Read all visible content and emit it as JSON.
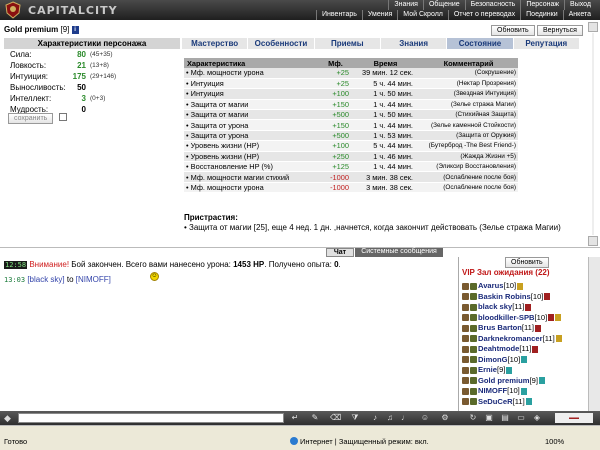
{
  "header": {
    "logo_text": "CAPITALCITY",
    "menu_row1": [
      "Знания",
      "Общение",
      "Безопасность",
      "Персонаж",
      "Выход"
    ],
    "menu_row2": [
      "Инвентарь",
      "Умения",
      "Мой Скролл",
      "Отчет о переводах",
      "Поединки",
      "Анкета"
    ]
  },
  "player": {
    "name": "Gold premium",
    "level": "[9]"
  },
  "buttons": {
    "refresh": "Обновить",
    "back": "Вернуться",
    "save": "сохранить",
    "refresh_right": "Обновить"
  },
  "stats": {
    "title": "Характеристики персонажа",
    "items": [
      {
        "label": "Сила:",
        "value": "80",
        "bonus": "(45+35)"
      },
      {
        "label": "Ловкость:",
        "value": "21",
        "bonus": "(13+8)"
      },
      {
        "label": "Интуиция:",
        "value": "175",
        "bonus": "(29+146)"
      },
      {
        "label": "Выносливость:",
        "value": "50",
        "bonus": ""
      },
      {
        "label": "Интеллект:",
        "value": "3",
        "bonus": "(0+3)"
      },
      {
        "label": "Мудрость:",
        "value": "0",
        "bonus": ""
      }
    ]
  },
  "tabs": [
    "Мастерство",
    "Особенности",
    "Приемы",
    "Знания",
    "Состояние",
    "Репутация"
  ],
  "effects": {
    "headers": [
      "Характеристика",
      "Мф.",
      "Время",
      "Комментарий"
    ],
    "rows": [
      {
        "name": "Мф. мощности урона",
        "mf": "+25",
        "time": "39 мин. 12 сек.",
        "comment": "(Сокрушение)"
      },
      {
        "name": "Интуиция",
        "mf": "+25",
        "time": "5 ч. 44 мин.",
        "comment": "(Нектар Прозрения)"
      },
      {
        "name": "Интуиция",
        "mf": "+100",
        "time": "1 ч. 50 мин.",
        "comment": "(Звездная Интуиция)"
      },
      {
        "name": "Защита от магии",
        "mf": "+150",
        "time": "1 ч. 44 мин.",
        "comment": "(Зелье стража Магии)"
      },
      {
        "name": "Защита от магии",
        "mf": "+500",
        "time": "1 ч. 50 мин.",
        "comment": "(Стихийная Защита)"
      },
      {
        "name": "Защита от урона",
        "mf": "+150",
        "time": "1 ч. 44 мин.",
        "comment": "(Зелье каменной Стойкости)"
      },
      {
        "name": "Защита от урона",
        "mf": "+500",
        "time": "1 ч. 53 мин.",
        "comment": "(Защита от Оружия)"
      },
      {
        "name": "Уровень жизни (HP)",
        "mf": "+100",
        "time": "5 ч. 44 мин.",
        "comment": "(Бутерброд -The Best Friend-)"
      },
      {
        "name": "Уровень жизни (HP)",
        "mf": "+250",
        "time": "1 ч. 46 мин.",
        "comment": "(Жажда Жизни +5)"
      },
      {
        "name": "Восстановление HP (%)",
        "mf": "+125",
        "time": "1 ч. 44 мин.",
        "comment": "(Эликсир Восстановления)"
      },
      {
        "name": "Мф. мощности магии стихий",
        "mf": "-1000",
        "time": "3 мин. 38 сек.",
        "comment": "(Ослабление после боя)"
      },
      {
        "name": "Мф. мощности урона",
        "mf": "-1000",
        "time": "3 мин. 38 сек.",
        "comment": "(Ослабление после боя)"
      }
    ]
  },
  "attachments": {
    "title": "Пристрастия:",
    "text": "• Защита от магии [25], еще 4 нед. 1 дн. ,начнется, когда закончит действовать (Зелье стража Магии)"
  },
  "chat_tabs": {
    "chat": "Чат",
    "system": "Системные сообщения"
  },
  "chat": {
    "msg1": {
      "time": "12:58",
      "warn": "Внимание!",
      "text_a": " Бой закончен. Всего вами нанесено урона: ",
      "damage": "1453 HP",
      "text_b": ". Получено опыта: ",
      "exp": "0",
      "end": "."
    },
    "msg2": {
      "time": "13:03",
      "from": "[black sky]",
      "to_word": " to ",
      "to": "[NIMOFF]"
    }
  },
  "waiting_room": {
    "title": "VIP Зал ожидания (22)",
    "users": [
      {
        "name": "Avarus",
        "level": "[10]"
      },
      {
        "name": "Baskin Robins",
        "level": "[10]"
      },
      {
        "name": "black sky",
        "level": "[11]"
      },
      {
        "name": "bloodkiller-SPB",
        "level": "[10]"
      },
      {
        "name": "Brus Barton",
        "level": "[11]"
      },
      {
        "name": "Darknekromancer",
        "level": "[11]"
      },
      {
        "name": "Deahtmode",
        "level": "[11]"
      },
      {
        "name": "DimonG",
        "level": "[10]"
      },
      {
        "name": "Ernie",
        "level": "[9]"
      },
      {
        "name": "Gold premium",
        "level": "[9]"
      },
      {
        "name": "NIMOFF",
        "level": "[10]"
      },
      {
        "name": "SeDuCeR",
        "level": "[11]"
      }
    ]
  },
  "status_bar": {
    "ready": "Готово",
    "zone": "Интернет | Защищенный режим: вкл.",
    "zoom": "100%"
  }
}
